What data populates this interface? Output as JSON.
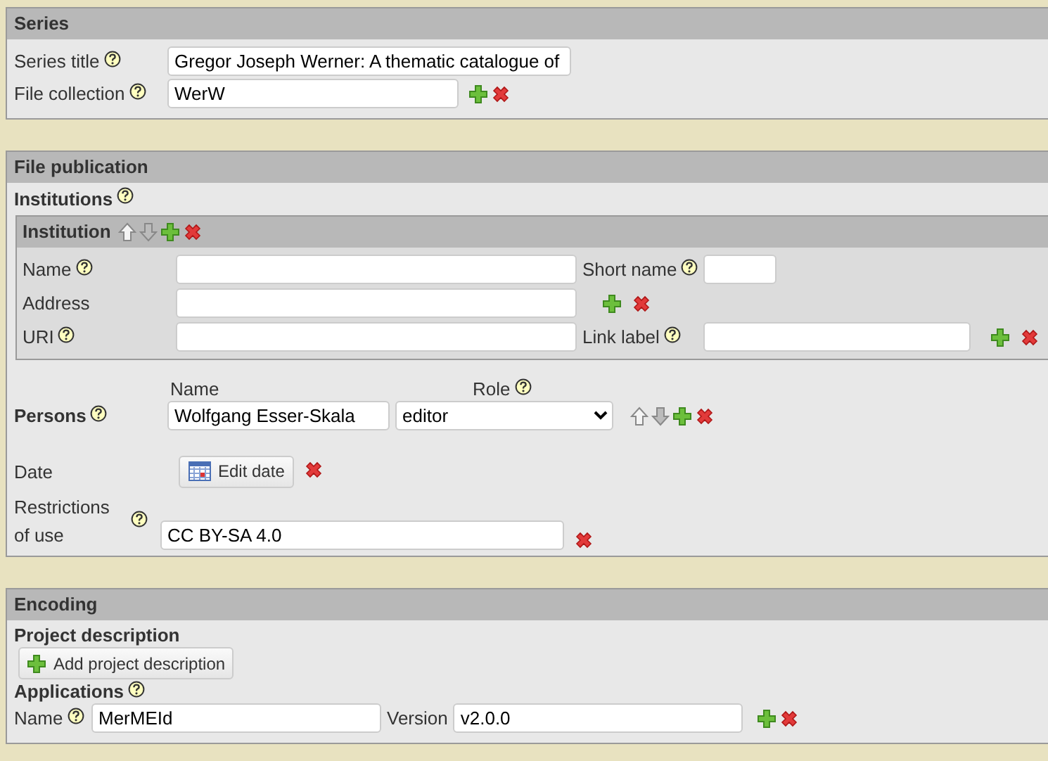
{
  "series": {
    "title": "Series",
    "fields": [
      {
        "label": "Series title",
        "help": true,
        "value": "Gregor Joseph Werner: A thematic catalogue of",
        "kind": "long"
      },
      {
        "label": "File collection",
        "help": true,
        "value": "WerW",
        "kind": "addable"
      }
    ]
  },
  "file_publication": {
    "title": "File publication",
    "institutions": {
      "label": "Institutions",
      "help": true,
      "items": [
        {
          "title": "Institution",
          "name": {
            "label": "Name",
            "help": true
          },
          "short_name": {
            "label": "Short name",
            "help": true
          },
          "address": {
            "label": "Address",
            "help": false
          },
          "uri": {
            "label": "URI",
            "help": true
          },
          "link_label": {
            "label": "Link label",
            "help": true
          }
        }
      ]
    },
    "persons": {
      "label": "Persons",
      "help": true,
      "columns": [
        {
          "label": "Name",
          "help": false
        },
        {
          "label": "Role",
          "help": true
        }
      ],
      "rows": [
        {
          "name": "Wolfgang Esser-Skala",
          "role": "editor"
        }
      ]
    },
    "date": {
      "label": "Date",
      "button": "Edit date"
    },
    "restrictions": {
      "label": "Restrictions of use",
      "help": true,
      "value": "CC BY-SA 4.0"
    }
  },
  "encoding": {
    "title": "Encoding",
    "project_description": {
      "label": "Project description",
      "button": "Add project description"
    },
    "applications": {
      "label": "Applications",
      "help": true,
      "items": [
        {
          "name_label": "Name",
          "name_help": true,
          "name": "MerMEId",
          "version_label": "Version",
          "version": "v2.0.0"
        }
      ]
    }
  }
}
